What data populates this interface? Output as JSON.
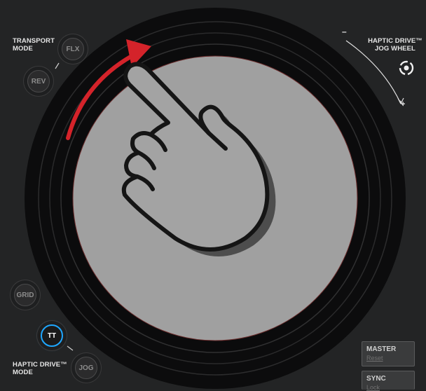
{
  "transport_mode": {
    "label_line1": "TRANSPORT",
    "label_line2": "MODE",
    "buttons": [
      {
        "label": "FLX"
      },
      {
        "label": "REV"
      }
    ]
  },
  "haptic_jog": {
    "label_line1": "HAPTIC DRIVE™",
    "label_line2": "JOG WHEEL",
    "minus": "–",
    "plus": "+"
  },
  "haptic_mode": {
    "label_line1": "HAPTIC DRIVE™",
    "label_line2": "MODE",
    "buttons": [
      {
        "label": "GRID",
        "active": false
      },
      {
        "label": "TT",
        "active": true
      },
      {
        "label": "JOG",
        "active": false
      }
    ]
  },
  "deck_buttons": {
    "master": {
      "label": "MASTER",
      "sub": "Reset"
    },
    "sync": {
      "label": "SYNC",
      "sub": "Lock"
    }
  },
  "colors": {
    "accent": "#1ea7ff",
    "arrow": "#d4232a",
    "platter": "#a0a0a0",
    "panel": "#232425"
  },
  "icons": {
    "gesture": "pointing-hand-icon",
    "direction": "clockwise-arrow-icon",
    "jog": "circular-arrows-icon"
  }
}
